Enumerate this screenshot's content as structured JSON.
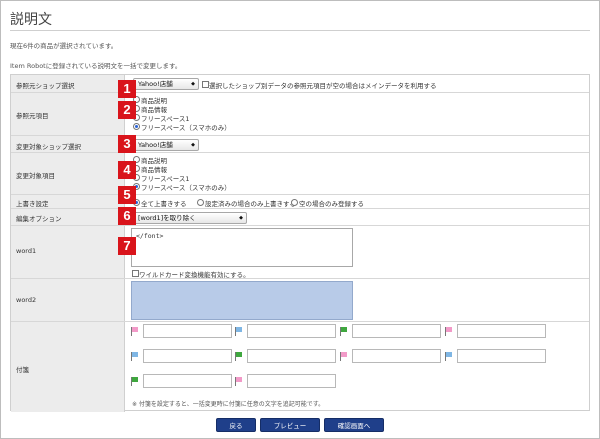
{
  "page": {
    "title": "説明文",
    "note_selected": "現在6件の商品が選択されています。",
    "note_bulk": "Item Robotに登録されている説明文を一括で変更します。"
  },
  "badges": [
    "1",
    "2",
    "3",
    "4",
    "5",
    "6",
    "7"
  ],
  "rows": {
    "ref_shop": {
      "label": "参照元ショップ選択",
      "select_value": "Yahoo!店舗",
      "checkbox_label": "選択したショップ別データの参照元項目が空の場合はメインデータを利用する"
    },
    "ref_item": {
      "label": "参照元項目",
      "options": [
        "商品説明",
        "商品情報",
        "フリースペース1",
        "フリースペース（スマホのみ）"
      ]
    },
    "target_shop": {
      "label": "変更対象ショップ選択",
      "select_value": "Yahoo!店舗"
    },
    "target_item": {
      "label": "変更対象項目",
      "options": [
        "商品説明",
        "商品情報",
        "フリースペース1",
        "フリースペース（スマホのみ）"
      ]
    },
    "overwrite": {
      "label": "上書き設定",
      "options": [
        "全て上書きする",
        "設定済みの場合のみ上書きする",
        "空の場合のみ登録する"
      ]
    },
    "edit_option": {
      "label": "編集オプション",
      "select_value": "[word1]を取り除く"
    },
    "word1": {
      "label": "word1",
      "value": "</font>",
      "wildcard_label": "ワイルドカード変換機能有効にする。"
    },
    "word2": {
      "label": "word2",
      "value": ""
    },
    "sticky": {
      "label": "付箋",
      "colors": [
        "#f29ac8",
        "#7fb6e4",
        "#3fa73f",
        "#f29ac8",
        "#7fb6e4",
        "#3fa73f",
        "#f29ac8",
        "#7fb6e4",
        "#3fa73f",
        "#f29ac8"
      ],
      "note": "※ 付箋を設定すると、一括変更時に付箋に任意の文字を追記可能です。"
    }
  },
  "buttons": {
    "back": "戻る",
    "preview": "プレビュー",
    "confirm": "確認画面へ"
  }
}
